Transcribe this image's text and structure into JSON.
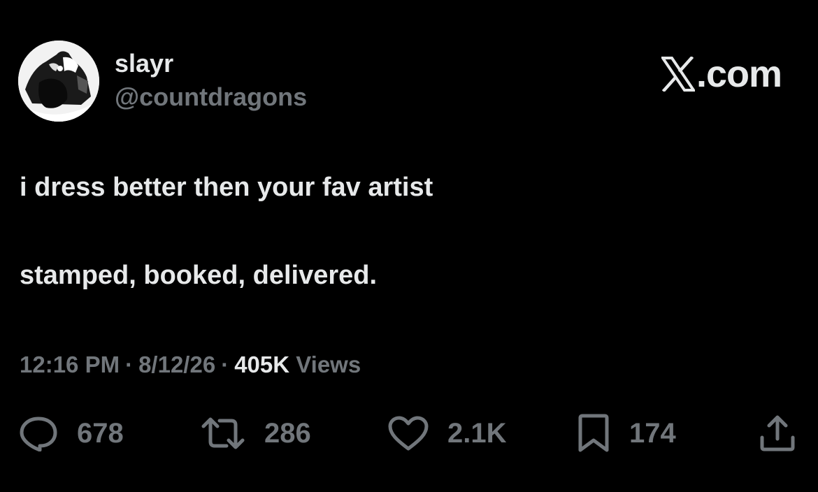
{
  "author": {
    "display_name": "slayr",
    "handle": "@countdragons"
  },
  "branding": {
    "domain": ".com",
    "icon": "x-logo-icon"
  },
  "tweet": {
    "lines": [
      "i dress better then your fav artist",
      "stamped, booked, delivered."
    ]
  },
  "meta": {
    "time": "12:16 PM",
    "date": "8/12/26",
    "separator": "·",
    "views_count": "405K",
    "views_label": "Views"
  },
  "actions": {
    "reply": {
      "icon": "reply-bubble-icon",
      "count": "678"
    },
    "retweet": {
      "icon": "retweet-icon",
      "count": "286"
    },
    "like": {
      "icon": "heart-icon",
      "count": "2.1K"
    },
    "bookmark": {
      "icon": "bookmark-icon",
      "count": "174"
    },
    "share": {
      "icon": "share-icon"
    }
  },
  "colors": {
    "background": "#000000",
    "primary_text": "#e7e9ea",
    "secondary_text": "#71767b"
  }
}
